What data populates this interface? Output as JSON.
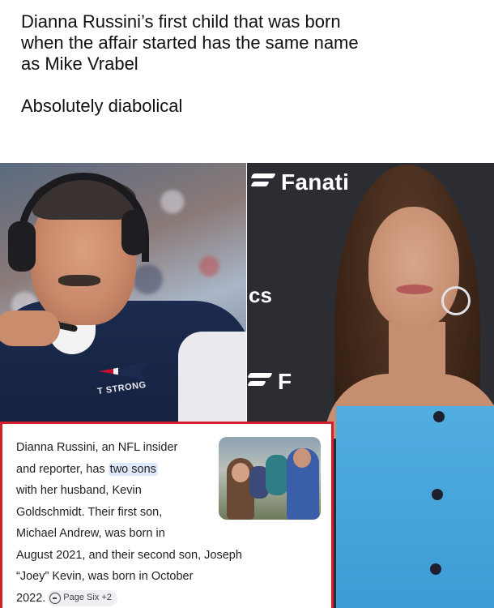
{
  "caption": {
    "line1": "Dianna Russini’s first child that was born",
    "line2": "when the affair started has the same name",
    "line3": "as Mike Vrabel",
    "line4": "Absolutely diabolical"
  },
  "left_photo": {
    "jacket_patch_text": "T STRONG"
  },
  "right_photo": {
    "backdrop_text_top": "Fanati",
    "backdrop_text_middle": "cs",
    "backdrop_text_bottom": "F"
  },
  "info_card": {
    "line1": "Dianna Russini, an NFL insider",
    "line2_prefix": "and reporter, has ",
    "line2_highlight": "two sons",
    "line3": "with her husband, Kevin",
    "line4": "Goldschmidt. Their first son,",
    "line5": "Michael Andrew, was born in",
    "line6": "August 2021, and their second son, Joseph",
    "line7": "“Joey” Kevin, was born in October",
    "line8": "2022.",
    "source_label": "Page Six +2",
    "border_color": "#d21f2a",
    "highlight_color": "#dfe9fb"
  }
}
